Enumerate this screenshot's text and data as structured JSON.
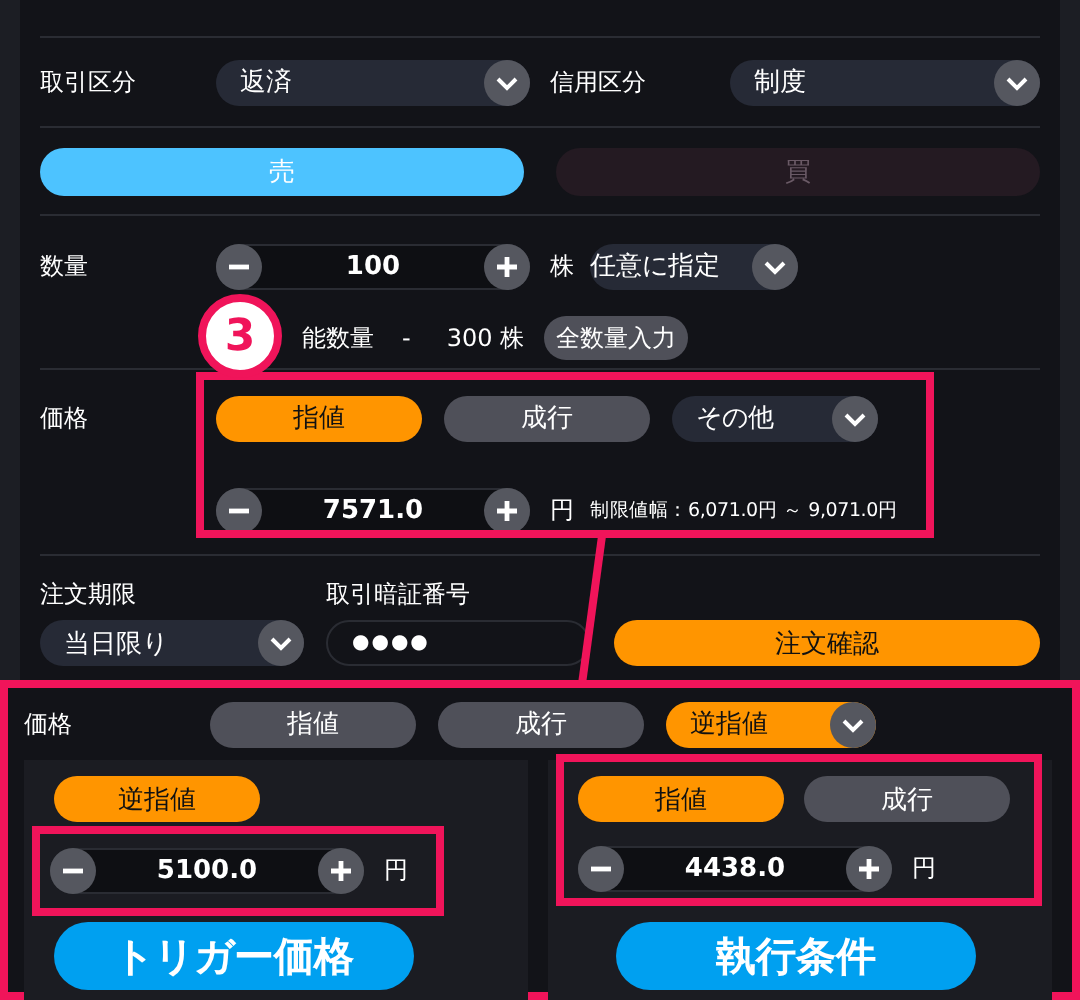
{
  "trade_type": {
    "label": "取引区分",
    "value": "返済"
  },
  "margin_type": {
    "label": "信用区分",
    "value": "制度"
  },
  "sides": [
    {
      "label": "売",
      "selected": true
    },
    {
      "label": "買",
      "selected": false
    }
  ],
  "quantity": {
    "label": "数量",
    "value": "100",
    "unit": "株",
    "mode": "任意に指定",
    "available_label": "能数量",
    "available_sep": "-",
    "available_value": "300 株",
    "fill_all_button": "全数量入力"
  },
  "price": {
    "label": "価格",
    "types": [
      {
        "label": "指値",
        "selected": true
      },
      {
        "label": "成行",
        "selected": false
      }
    ],
    "other": {
      "label": "その他",
      "selected": false
    },
    "value": "7571.0",
    "unit": "円",
    "range": "制限値幅：6,071.0円 ～ 9,071.0円"
  },
  "expiry": {
    "label": "注文期限",
    "value": "当日限り"
  },
  "pin": {
    "label": "取引暗証番号",
    "value": "●●●●"
  },
  "confirm_button": "注文確認",
  "detail": {
    "label": "価格",
    "types": [
      {
        "label": "指値",
        "selected": false
      },
      {
        "label": "成行",
        "selected": false
      }
    ],
    "other": {
      "label": "逆指値",
      "selected": true
    },
    "trigger": {
      "type_label": "逆指値",
      "value": "5100.0",
      "unit": "円"
    },
    "execution": {
      "types": [
        {
          "label": "指値",
          "selected": true
        },
        {
          "label": "成行",
          "selected": false
        }
      ],
      "value": "4438.0",
      "unit": "円"
    }
  },
  "annotations": {
    "step": "3",
    "trigger_label": "トリガー価格",
    "execution_label": "執行条件"
  }
}
